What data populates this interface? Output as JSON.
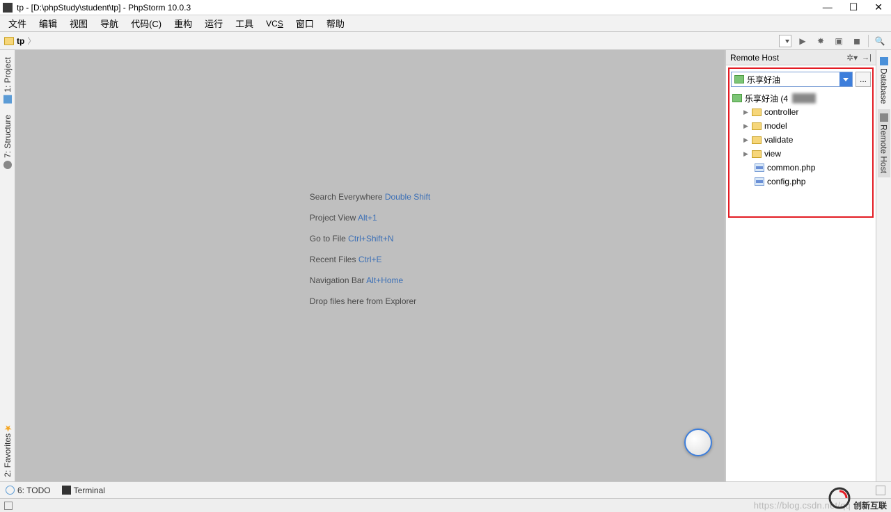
{
  "window": {
    "title": "tp - [D:\\phpStudy\\student\\tp] - PhpStorm 10.0.3"
  },
  "menu": {
    "file": "文件",
    "edit": "编辑",
    "view": "视图",
    "navigate": "导航",
    "code": "代码(C)",
    "refactor": "重构",
    "run": "运行",
    "tools": "工具",
    "vcs": "VCS",
    "window": "窗口",
    "help": "帮助"
  },
  "breadcrumb": {
    "root": "tp"
  },
  "left_tabs": {
    "project": "1: Project",
    "structure": "7: Structure",
    "favorites": "2: Favorites"
  },
  "right_tabs": {
    "database": "Database",
    "remote_host": "Remote Host"
  },
  "welcome": {
    "search_label": "Search Everywhere ",
    "search_kb": "Double Shift",
    "project_label": "Project View ",
    "project_kb": "Alt+1",
    "goto_label": "Go to File ",
    "goto_kb": "Ctrl+Shift+N",
    "recent_label": "Recent Files ",
    "recent_kb": "Ctrl+E",
    "nav_label": "Navigation Bar ",
    "nav_kb": "Alt+Home",
    "drop": "Drop files here from Explorer"
  },
  "remote_host": {
    "title": "Remote Host",
    "selected": "乐享好油",
    "more": "...",
    "root": "乐享好油 (4",
    "folders": {
      "controller": "controller",
      "model": "model",
      "validate": "validate",
      "view": "view"
    },
    "files": {
      "common": "common.php",
      "config": "config.php"
    }
  },
  "bottom": {
    "todo": "6: TODO",
    "terminal": "Terminal"
  },
  "status": {
    "watermark": "https://blog.csdn.net/qq",
    "brand": "创新互联"
  }
}
